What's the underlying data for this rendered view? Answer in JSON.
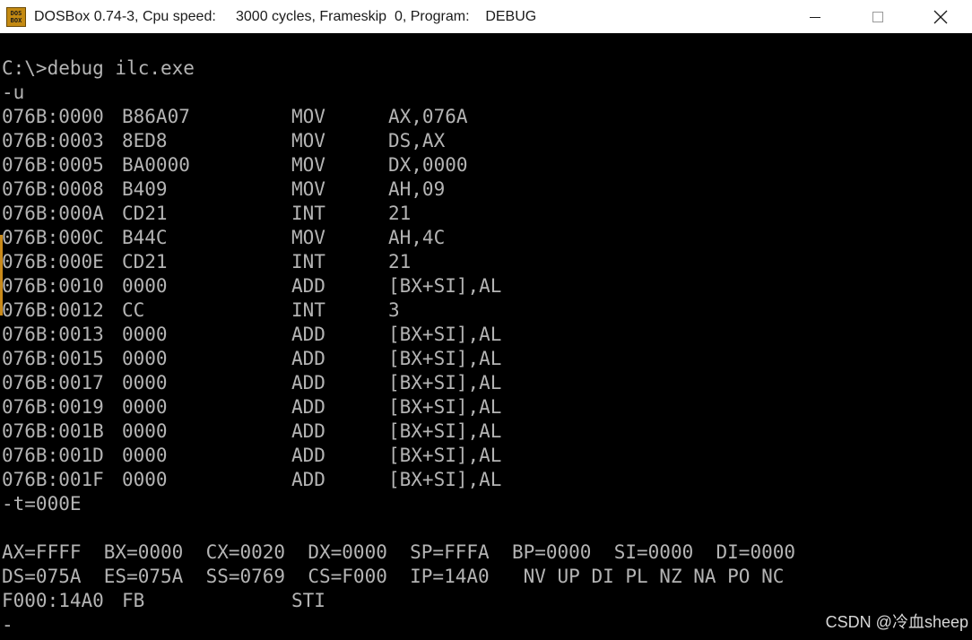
{
  "window": {
    "icon_text_top": "DOS",
    "icon_text_bottom": "BOX",
    "title": "DOSBox 0.74-3, Cpu speed:     3000 cycles, Frameskip  0, Program:    DEBUG"
  },
  "console": {
    "command": "C:\\>debug ilc.exe",
    "unassemble_cmd": "-u",
    "disassembly": [
      {
        "address": "076B:0000",
        "bytes": "B86A07",
        "mnemonic": "MOV",
        "operands": "AX,076A"
      },
      {
        "address": "076B:0003",
        "bytes": "8ED8",
        "mnemonic": "MOV",
        "operands": "DS,AX"
      },
      {
        "address": "076B:0005",
        "bytes": "BA0000",
        "mnemonic": "MOV",
        "operands": "DX,0000"
      },
      {
        "address": "076B:0008",
        "bytes": "B409",
        "mnemonic": "MOV",
        "operands": "AH,09"
      },
      {
        "address": "076B:000A",
        "bytes": "CD21",
        "mnemonic": "INT",
        "operands": "21"
      },
      {
        "address": "076B:000C",
        "bytes": "B44C",
        "mnemonic": "MOV",
        "operands": "AH,4C"
      },
      {
        "address": "076B:000E",
        "bytes": "CD21",
        "mnemonic": "INT",
        "operands": "21"
      },
      {
        "address": "076B:0010",
        "bytes": "0000",
        "mnemonic": "ADD",
        "operands": "[BX+SI],AL"
      },
      {
        "address": "076B:0012",
        "bytes": "CC",
        "mnemonic": "INT",
        "operands": "3"
      },
      {
        "address": "076B:0013",
        "bytes": "0000",
        "mnemonic": "ADD",
        "operands": "[BX+SI],AL"
      },
      {
        "address": "076B:0015",
        "bytes": "0000",
        "mnemonic": "ADD",
        "operands": "[BX+SI],AL"
      },
      {
        "address": "076B:0017",
        "bytes": "0000",
        "mnemonic": "ADD",
        "operands": "[BX+SI],AL"
      },
      {
        "address": "076B:0019",
        "bytes": "0000",
        "mnemonic": "ADD",
        "operands": "[BX+SI],AL"
      },
      {
        "address": "076B:001B",
        "bytes": "0000",
        "mnemonic": "ADD",
        "operands": "[BX+SI],AL"
      },
      {
        "address": "076B:001D",
        "bytes": "0000",
        "mnemonic": "ADD",
        "operands": "[BX+SI],AL"
      },
      {
        "address": "076B:001F",
        "bytes": "0000",
        "mnemonic": "ADD",
        "operands": "[BX+SI],AL"
      }
    ],
    "trace_cmd": "-t=000E",
    "registers_line1": "AX=FFFF  BX=0000  CX=0020  DX=0000  SP=FFFA  BP=0000  SI=0000  DI=0000",
    "registers_line2": "DS=075A  ES=075A  SS=0769  CS=F000  IP=14A0   NV UP DI PL NZ NA PO NC",
    "current_instr": {
      "address": "F000:14A0",
      "bytes": "FB",
      "mnemonic": "STI"
    },
    "prompt": "-"
  },
  "watermark": "CSDN @冷血sheep"
}
